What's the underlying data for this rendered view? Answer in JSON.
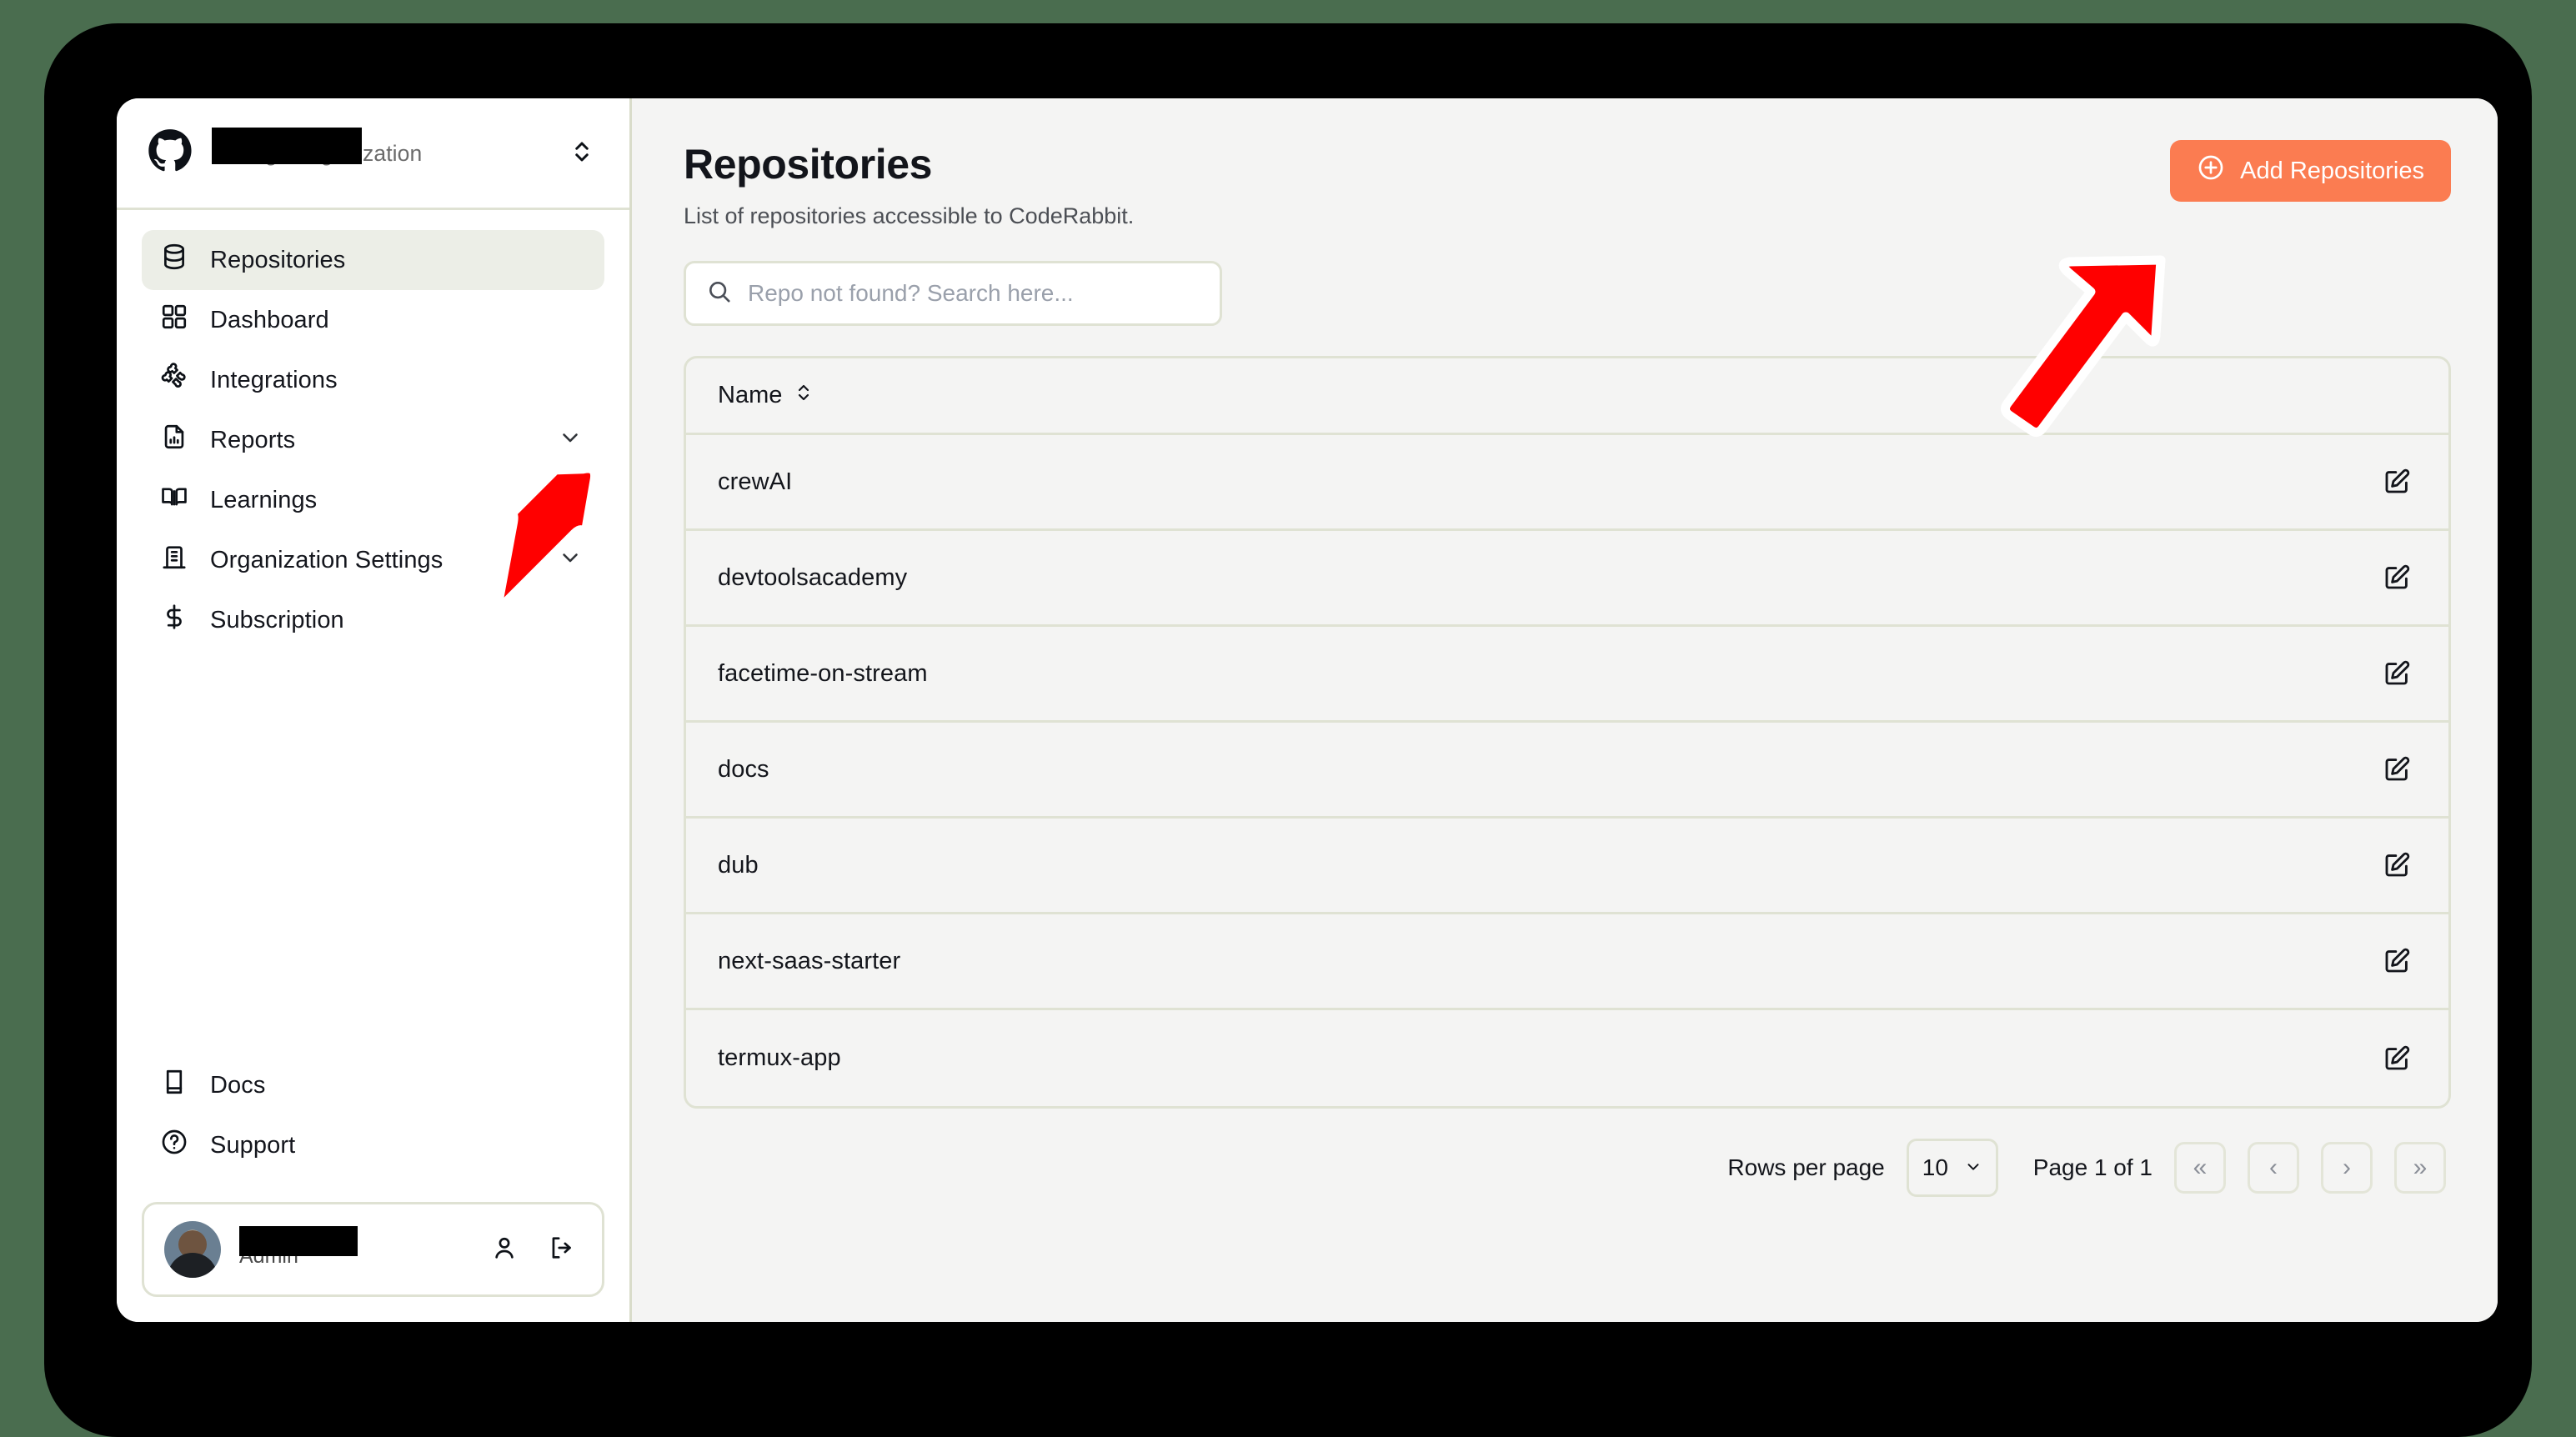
{
  "sidebar": {
    "org": {
      "logo_icon": "github-icon",
      "name_redacted": true,
      "change_label": "Change Organization",
      "switch_icon": "chevron-up-down-icon"
    },
    "primary_items": [
      {
        "id": "repositories",
        "label": "Repositories",
        "icon": "database-icon",
        "active": true,
        "expandable": false
      },
      {
        "id": "dashboard",
        "label": "Dashboard",
        "icon": "grid-icon",
        "active": false,
        "expandable": false
      },
      {
        "id": "integrations",
        "label": "Integrations",
        "icon": "puzzle-icon",
        "active": false,
        "expandable": false
      },
      {
        "id": "reports",
        "label": "Reports",
        "icon": "report-icon",
        "active": false,
        "expandable": true
      },
      {
        "id": "learnings",
        "label": "Learnings",
        "icon": "book-icon",
        "active": false,
        "expandable": false
      },
      {
        "id": "org-settings",
        "label": "Organization Settings",
        "icon": "building-icon",
        "active": false,
        "expandable": true
      },
      {
        "id": "subscription",
        "label": "Subscription",
        "icon": "dollar-icon",
        "active": false,
        "expandable": false
      }
    ],
    "secondary_items": [
      {
        "id": "docs",
        "label": "Docs",
        "icon": "book-closed-icon"
      },
      {
        "id": "support",
        "label": "Support",
        "icon": "question-circle-icon"
      }
    ],
    "user": {
      "name_redacted": true,
      "role": "Admin",
      "avatar_icon": "avatar",
      "account_icon": "person-icon",
      "logout_icon": "logout-icon"
    }
  },
  "main": {
    "title": "Repositories",
    "subtitle": "List of repositories accessible to CodeRabbit.",
    "add_button": {
      "label": "Add Repositories",
      "icon": "plus-circle-icon"
    },
    "search": {
      "value": "",
      "placeholder": "Repo not found? Search here...",
      "icon": "search-icon"
    },
    "table": {
      "columns": [
        {
          "label": "Name",
          "sort_icon": "chevron-up-down-icon"
        }
      ],
      "rows": [
        {
          "name": "crewAI",
          "action_icon": "edit-icon"
        },
        {
          "name": "devtoolsacademy",
          "action_icon": "edit-icon"
        },
        {
          "name": "facetime-on-stream",
          "action_icon": "edit-icon"
        },
        {
          "name": "docs",
          "action_icon": "edit-icon"
        },
        {
          "name": "dub",
          "action_icon": "edit-icon"
        },
        {
          "name": "next-saas-starter",
          "action_icon": "edit-icon"
        },
        {
          "name": "termux-app",
          "action_icon": "edit-icon"
        }
      ]
    },
    "pagination": {
      "rows_per_page_label": "Rows per page",
      "rows_per_page_value": "10",
      "page_label": "Page 1 of 1",
      "first_label": "«",
      "prev_label": "‹",
      "next_label": "›",
      "last_label": "»"
    }
  },
  "annotations": [
    {
      "id": "arrow-sidebar",
      "icon": "red-arrow-icon",
      "points_to": "integrations"
    },
    {
      "id": "arrow-addrepo",
      "icon": "red-arrow-icon",
      "points_to": "add-repositories-button"
    }
  ],
  "colors": {
    "page_background": "#4a6d4f",
    "frame": "#000000",
    "card": "#f4f4f3",
    "sidebar": "#ffffff",
    "accent": "#fb7c51",
    "border": "#dfe2d3",
    "annotation": "#ff0000"
  }
}
